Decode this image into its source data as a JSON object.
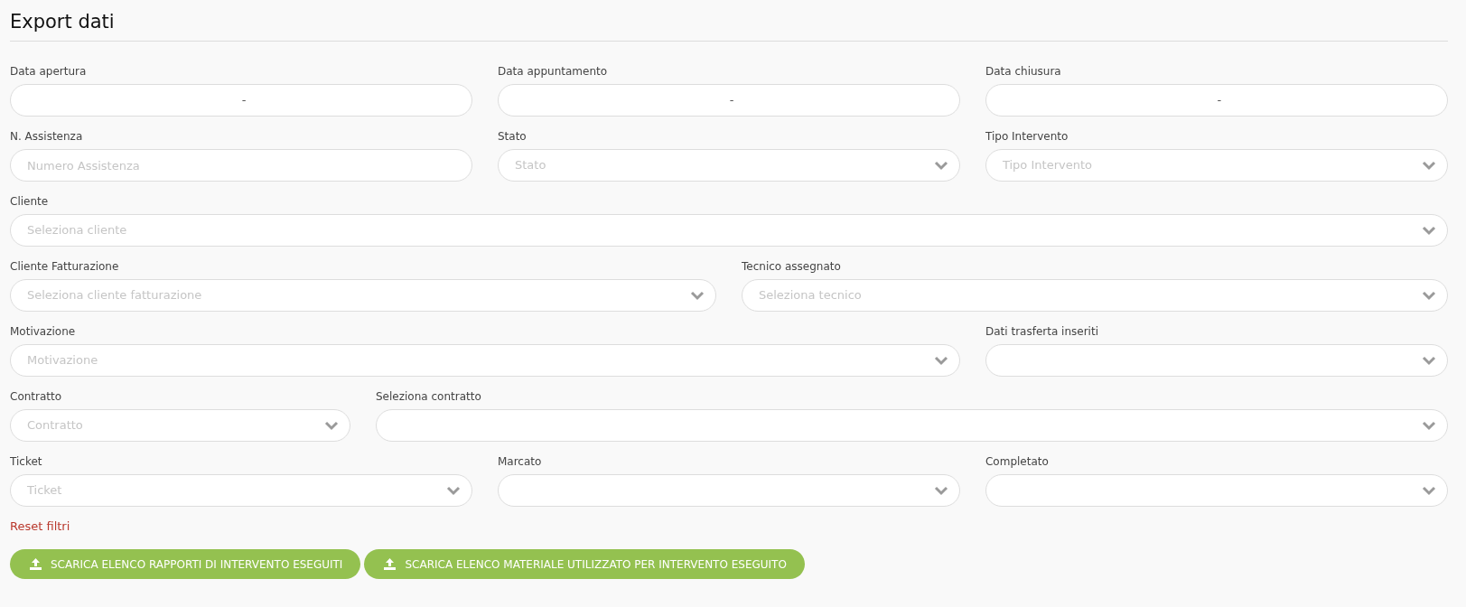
{
  "title": "Export dati",
  "rows": [
    [
      {
        "kind": "date-range",
        "label": "Data apertura",
        "separator": "-"
      },
      {
        "kind": "date-range",
        "label": "Data appuntamento",
        "separator": "-"
      },
      {
        "kind": "date-range",
        "label": "Data chiusura",
        "separator": "-"
      }
    ],
    [
      {
        "kind": "text",
        "label": "N. Assistenza",
        "placeholder": "Numero Assistenza"
      },
      {
        "kind": "select",
        "label": "Stato",
        "placeholder": "Stato"
      },
      {
        "kind": "select",
        "label": "Tipo Intervento",
        "placeholder": "Tipo Intervento"
      }
    ],
    [
      {
        "kind": "select",
        "label": "Cliente",
        "placeholder": "Seleziona cliente"
      }
    ],
    [
      {
        "kind": "select",
        "label": "Cliente Fatturazione",
        "placeholder": "Seleziona cliente fatturazione"
      },
      {
        "kind": "select",
        "label": "Tecnico assegnato",
        "placeholder": "Seleziona tecnico"
      }
    ],
    [
      {
        "kind": "select",
        "label": "Motivazione",
        "placeholder": "Motivazione"
      },
      {
        "kind": "select",
        "label": "Dati trasferta inseriti"
      }
    ],
    [
      {
        "kind": "select",
        "label": "Contratto",
        "placeholder": "Contratto"
      },
      {
        "kind": "select",
        "label": "Seleziona contratto"
      }
    ],
    [
      {
        "kind": "select",
        "label": "Ticket",
        "placeholder": "Ticket"
      },
      {
        "kind": "select",
        "label": "Marcato"
      },
      {
        "kind": "select",
        "label": "Completato"
      }
    ]
  ],
  "reset_link": "Reset filtri",
  "buttons": [
    "SCARICA ELENCO RAPPORTI DI INTERVENTO ESEGUITI",
    "SCARICA ELENCO MATERIALE UTILIZZATO PER INTERVENTO ESEGUITO"
  ]
}
